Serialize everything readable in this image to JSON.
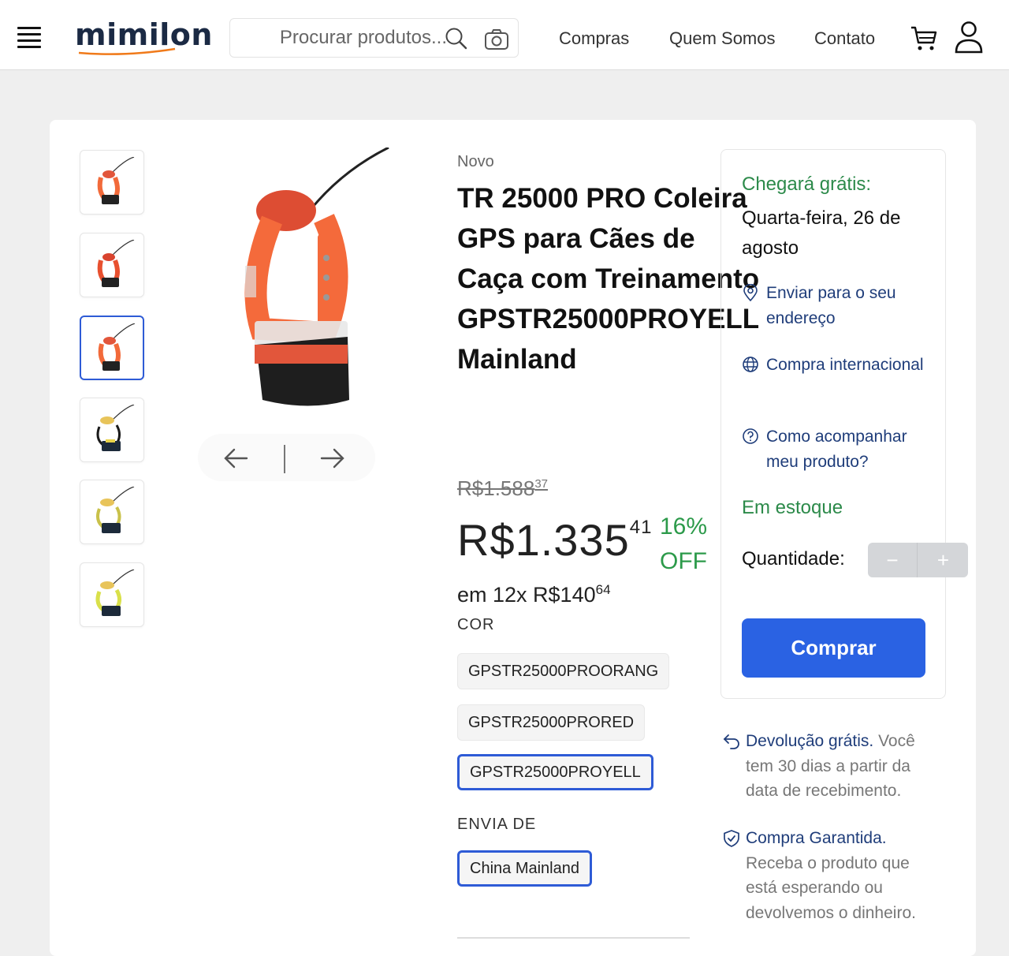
{
  "header": {
    "logo": "mimilon",
    "search_placeholder": "Procurar produtos...",
    "nav": [
      "Compras",
      "Quem Somos",
      "Contato"
    ]
  },
  "gallery": {
    "thumbnails": [
      {
        "color": "orange"
      },
      {
        "color": "red"
      },
      {
        "color": "orange",
        "selected": true
      },
      {
        "color": "yellow"
      },
      {
        "color": "yellow"
      },
      {
        "color": "yellow"
      }
    ]
  },
  "product": {
    "condition": "Novo",
    "title": "TR 25000 PRO Coleira GPS para Cães de Caça com Treinamento GPSTR25000PROYELL Mainland",
    "old_price_main": "R$1.588",
    "old_price_cents": "37",
    "price_main": "R$1.335",
    "price_cents": "41",
    "discount": "16% OFF",
    "installments_main": "em 12x R$140",
    "installments_cents": "64",
    "color_label": "COR",
    "variants": [
      {
        "label": "GPSTR25000PROORANG",
        "selected": false
      },
      {
        "label": "GPSTR25000PRORED",
        "selected": false
      },
      {
        "label": "GPSTR25000PROYELL",
        "selected": true
      }
    ],
    "ships_from_label": "ENVIA DE",
    "ships_from": "China Mainland"
  },
  "sidebox": {
    "shipping_title": "Chegará grátis:",
    "shipping_date": "Quarta-feira, 26 de agosto",
    "links": [
      {
        "icon": "location-pin-icon",
        "label": "Enviar para o seu endereço"
      },
      {
        "icon": "globe-icon",
        "label": "Compra internacional"
      },
      {
        "icon": "help-circle-icon",
        "label": "Como acompanhar meu produto?"
      }
    ],
    "stock": "Em estoque",
    "quantity_label": "Quantidade:",
    "minus": "−",
    "plus": "+",
    "buy": "Comprar"
  },
  "policies": [
    {
      "icon": "return-arrow-icon",
      "lead": "Devolução grátis.",
      "text": " Você tem 30 dias a partir da data de recebimento."
    },
    {
      "icon": "shield-check-icon",
      "lead": "Compra Garantida.",
      "text": " Receba o produto que está esperando ou devolvemos o dinheiro."
    }
  ],
  "colors": {
    "accent": "#2a62e3",
    "green": "#2c9a4a",
    "link": "#1f3d7a"
  }
}
